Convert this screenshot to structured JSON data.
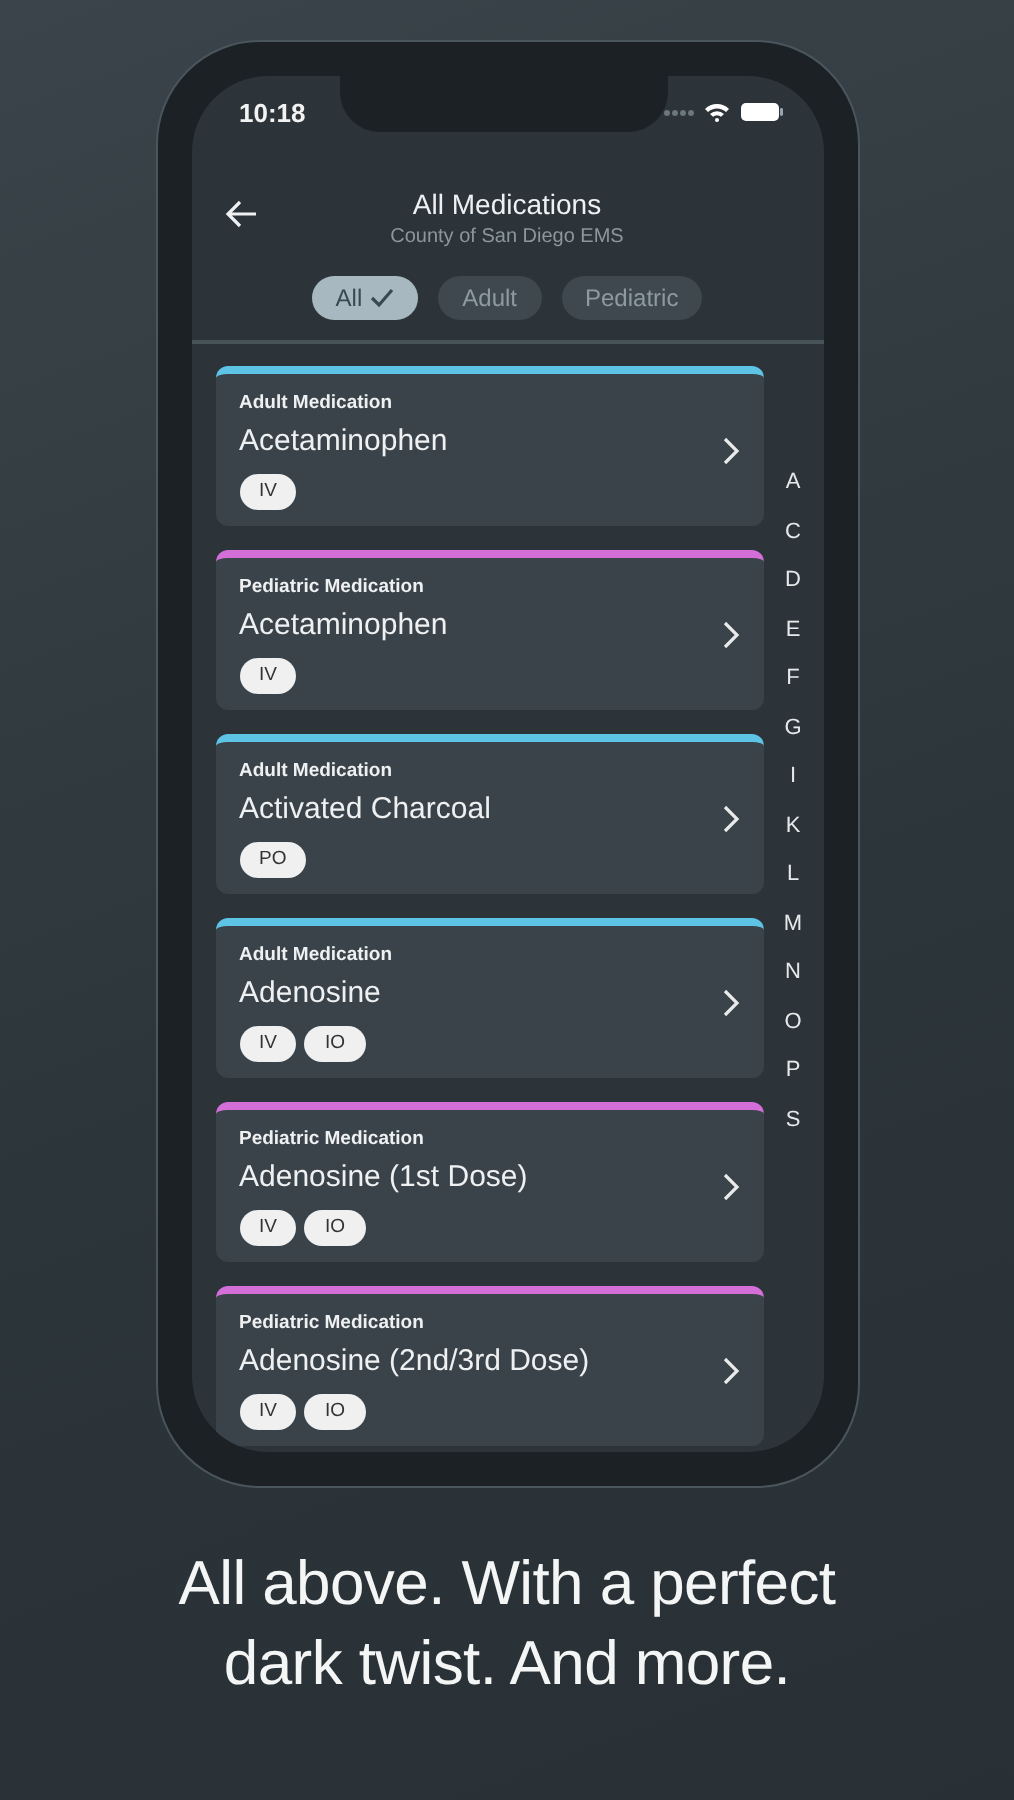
{
  "status_bar": {
    "time": "10:18"
  },
  "header": {
    "title": "All Medications",
    "subtitle": "County of San Diego EMS"
  },
  "filters": [
    {
      "label": "All",
      "selected": true
    },
    {
      "label": "Adult",
      "selected": false
    },
    {
      "label": "Pediatric",
      "selected": false
    }
  ],
  "medications": [
    {
      "category": "Adult Medication",
      "name": "Acetaminophen",
      "routes": [
        "IV"
      ],
      "color": "#5ec4e6"
    },
    {
      "category": "Pediatric Medication",
      "name": "Acetaminophen",
      "routes": [
        "IV"
      ],
      "color": "#d46ed8"
    },
    {
      "category": "Adult Medication",
      "name": "Activated Charcoal",
      "routes": [
        "PO"
      ],
      "color": "#5ec4e6"
    },
    {
      "category": "Adult Medication",
      "name": "Adenosine",
      "routes": [
        "IV",
        "IO"
      ],
      "color": "#5ec4e6"
    },
    {
      "category": "Pediatric Medication",
      "name": "Adenosine (1st Dose)",
      "routes": [
        "IV",
        "IO"
      ],
      "color": "#d46ed8"
    },
    {
      "category": "Pediatric Medication",
      "name": "Adenosine (2nd/3rd Dose)",
      "routes": [
        "IV",
        "IO"
      ],
      "color": "#d46ed8"
    }
  ],
  "index": [
    "A",
    "C",
    "D",
    "E",
    "F",
    "G",
    "I",
    "K",
    "L",
    "M",
    "N",
    "O",
    "P",
    "S"
  ],
  "caption": "All above. With a perfect dark twist. And more."
}
